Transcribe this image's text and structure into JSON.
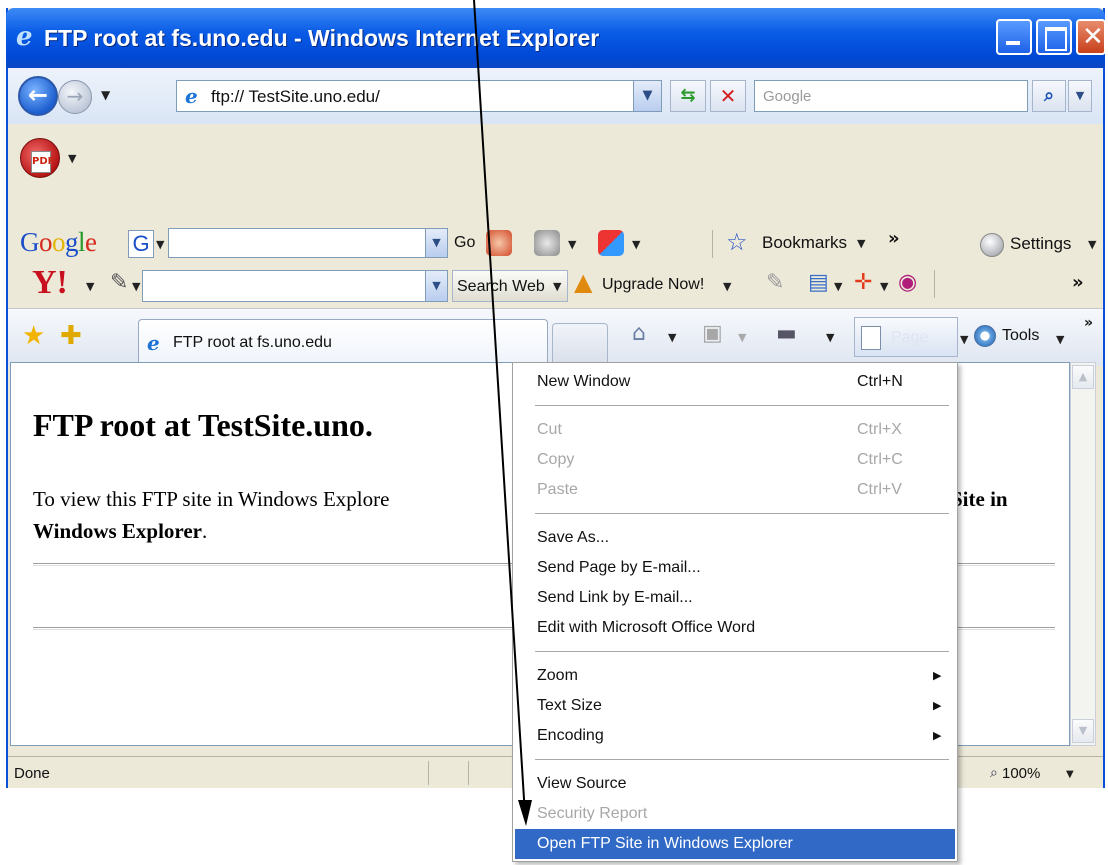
{
  "window": {
    "title": "FTP root at fs.uno.edu - Windows Internet Explorer",
    "close_glyph": "✕"
  },
  "navbar": {
    "url": "ftp:// TestSite.uno.edu/",
    "search_placeholder": "Google",
    "back_glyph": "←",
    "forward_glyph": "→",
    "refresh_glyph": "⇆",
    "stop_glyph": "✕",
    "search_glyph": "⌕"
  },
  "google_toolbar": {
    "logo": [
      "G",
      "o",
      "o",
      "g",
      "l",
      "e"
    ],
    "logo_colors": [
      "#1a4ec9",
      "#d62a1e",
      "#e4b40a",
      "#1a4ec9",
      "#2a9a2a",
      "#d62a1e"
    ],
    "g_icon": "G",
    "go_label": "Go",
    "bookmarks_label": "Bookmarks",
    "settings_label": "Settings",
    "more_glyph": "»"
  },
  "yahoo_toolbar": {
    "logo": "Y!",
    "search_web_label": "Search Web",
    "upgrade_label": "Upgrade Now!",
    "more_glyph": "»"
  },
  "tab_bar": {
    "active_tab_label": "FTP root at fs.uno.edu",
    "page_label": "Page",
    "tools_label": "Tools",
    "more_glyph": "»"
  },
  "content": {
    "heading": "FTP root at TestSite.uno.",
    "line1": "To view this FTP site in Windows Explore",
    "line1_tail": "Site in",
    "line2_bold": "Windows Explorer",
    "line2_end": "."
  },
  "statusbar": {
    "status": "Done",
    "zoom": "100%"
  },
  "context_menu": {
    "items": [
      {
        "label": "New Window",
        "shortcut": "Ctrl+N",
        "disabled": false
      },
      {
        "label": "Cut",
        "shortcut": "Ctrl+X",
        "disabled": true
      },
      {
        "label": "Copy",
        "shortcut": "Ctrl+C",
        "disabled": true
      },
      {
        "label": "Paste",
        "shortcut": "Ctrl+V",
        "disabled": true
      },
      {
        "label": "Save As...",
        "shortcut": "",
        "disabled": false
      },
      {
        "label": "Send Page by E-mail...",
        "shortcut": "",
        "disabled": false
      },
      {
        "label": "Send Link by E-mail...",
        "shortcut": "",
        "disabled": false
      },
      {
        "label": "Edit with Microsoft Office Word",
        "shortcut": "",
        "disabled": false
      },
      {
        "label": "Zoom",
        "shortcut": "",
        "disabled": false,
        "submenu": true
      },
      {
        "label": "Text Size",
        "shortcut": "",
        "disabled": false,
        "submenu": true
      },
      {
        "label": "Encoding",
        "shortcut": "",
        "disabled": false,
        "submenu": true
      },
      {
        "label": "View Source",
        "shortcut": "",
        "disabled": false
      },
      {
        "label": "Security Report",
        "shortcut": "",
        "disabled": true
      },
      {
        "label": "Open FTP Site in Windows Explorer",
        "shortcut": "",
        "disabled": false,
        "highlighted": true
      }
    ],
    "highlight_color": "#3169c6"
  },
  "colors": {
    "titlebar": "#0a5ce6",
    "window_frame": "#ece9d8",
    "menu_highlight": "#3169c6"
  }
}
